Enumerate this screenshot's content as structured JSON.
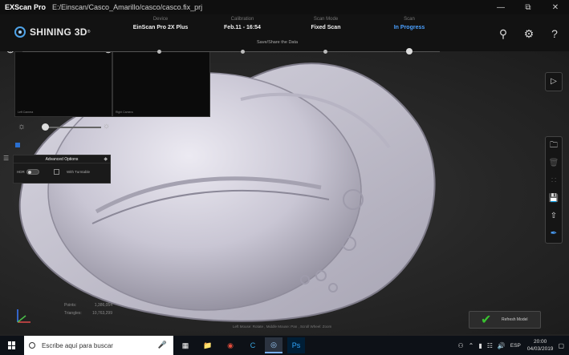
{
  "window": {
    "app_name": "EXScan Pro",
    "path": "E:/Einscan/Casco_Amarillo/casco/casco.fix_prj"
  },
  "brand": {
    "logo_text": "SHINING 3D",
    "logo_mark": "®"
  },
  "status": [
    {
      "label": "Device",
      "value": "EinScan Pro 2X Plus"
    },
    {
      "label": "Calibration",
      "value": "Feb.11 - 16:54"
    },
    {
      "label": "Scan Mode",
      "value": "Fixed Scan"
    },
    {
      "label": "Scan",
      "value": "In Progress"
    }
  ],
  "progress_strip": {
    "label": "Save/Share the Data"
  },
  "cameras": [
    {
      "caption": "Left Camera"
    },
    {
      "caption": "Right Camera"
    }
  ],
  "advanced_options": {
    "title": "Advanced Options",
    "hdr_label": "HDR",
    "turntable_label": "With Turntable"
  },
  "stats": {
    "points_label": "Points:",
    "points_value": "1,386,054",
    "triangles_label": "Triangles:",
    "triangles_value": "10,763,299"
  },
  "mouse_hint": "Left Mouse: Rotate , Middle Mouse: Pan , Scroll Wheel: Zoom",
  "refresh_button": {
    "label": "Refresh Model"
  },
  "taskbar": {
    "search_placeholder": "Escribe aquí para buscar",
    "language": "ESP",
    "time": "20:00",
    "date": "04/03/2019"
  },
  "icons": {
    "share": "share-icon",
    "settings": "gear-icon",
    "help": "help-icon",
    "play": "play-icon",
    "folder": "folder-icon",
    "delete": "trash-icon",
    "points": "scatter-icon",
    "save": "save-icon",
    "export": "export-icon",
    "edit": "brush-icon"
  },
  "colors": {
    "accent_blue": "#4aa0ff",
    "check_green": "#39c230",
    "model_surface": "#d6d4e0"
  }
}
